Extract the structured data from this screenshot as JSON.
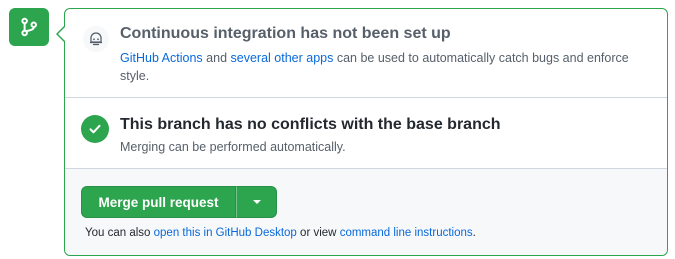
{
  "colors": {
    "success": "#2da44e",
    "link": "#0969da",
    "muted": "#57606a",
    "border": "#d0d7de",
    "footer_bg": "#f6f8fa"
  },
  "badge": {
    "icon": "git-branch-icon"
  },
  "ci": {
    "icon": "robot-icon",
    "title": "Continuous integration has not been set up",
    "link_actions": "GitHub Actions",
    "text_and": "and",
    "link_other_apps": "several other apps",
    "text_rest": "can be used to automatically catch bugs and enforce style."
  },
  "status": {
    "icon": "check-circle-icon",
    "title": "This branch has no conflicts with the base branch",
    "description": "Merging can be performed automatically."
  },
  "merge": {
    "button_label": "Merge pull request",
    "dropdown_icon": "chevron-down-icon",
    "note_prefix": "You can also",
    "link_desktop": "open this in GitHub Desktop",
    "note_middle": "or view",
    "link_cli": "command line instructions",
    "note_suffix": "."
  }
}
